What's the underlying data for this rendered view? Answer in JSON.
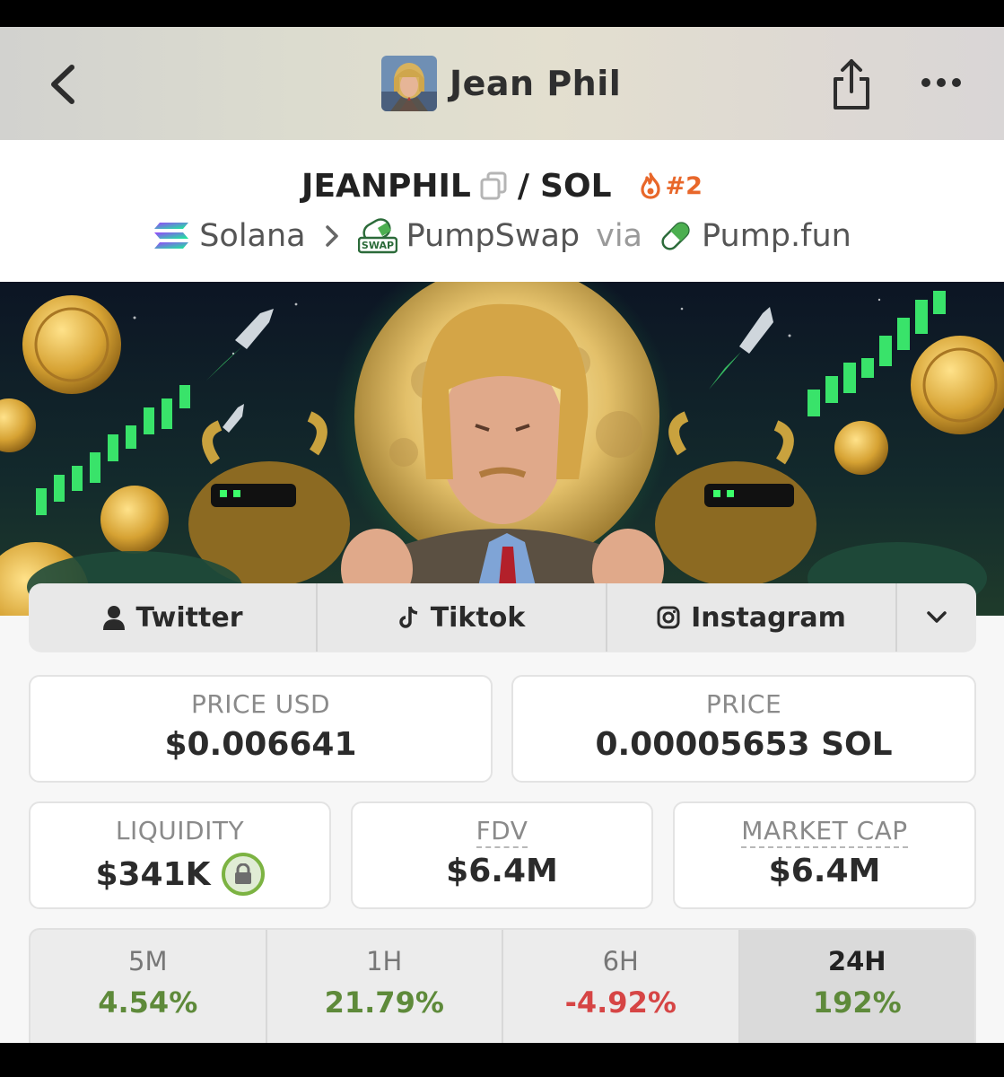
{
  "nav": {
    "title": "Jean Phil"
  },
  "pair": {
    "base": "JEANPHIL",
    "separator": "/",
    "quote": "SOL",
    "rank": "#2"
  },
  "chain": {
    "network": "Solana",
    "dex": "PumpSwap",
    "via": "via",
    "launchpad": "Pump.fun",
    "swap_badge": "SWAP"
  },
  "socials": [
    {
      "label": "Twitter",
      "icon": "user-icon"
    },
    {
      "label": "Tiktok",
      "icon": "tiktok-icon"
    },
    {
      "label": "Instagram",
      "icon": "instagram-icon"
    }
  ],
  "stats": {
    "price_usd_label": "PRICE USD",
    "price_usd": "$0.006641",
    "price_label": "PRICE",
    "price": "0.00005653 SOL",
    "liquidity_label": "LIQUIDITY",
    "liquidity": "$341K",
    "fdv_label": "FDV",
    "fdv": "$6.4M",
    "mcap_label": "MARKET CAP",
    "mcap": "$6.4M"
  },
  "periods": [
    {
      "label": "5M",
      "value": "4.54%",
      "trend": "up"
    },
    {
      "label": "1H",
      "value": "21.79%",
      "trend": "up"
    },
    {
      "label": "6H",
      "value": "-4.92%",
      "trend": "down"
    },
    {
      "label": "24H",
      "value": "192%",
      "trend": "up",
      "active": true
    }
  ],
  "colors": {
    "positive": "#5e8a3a",
    "negative": "#d64545",
    "rank": "#e8672a",
    "lock": "#7cb342"
  }
}
